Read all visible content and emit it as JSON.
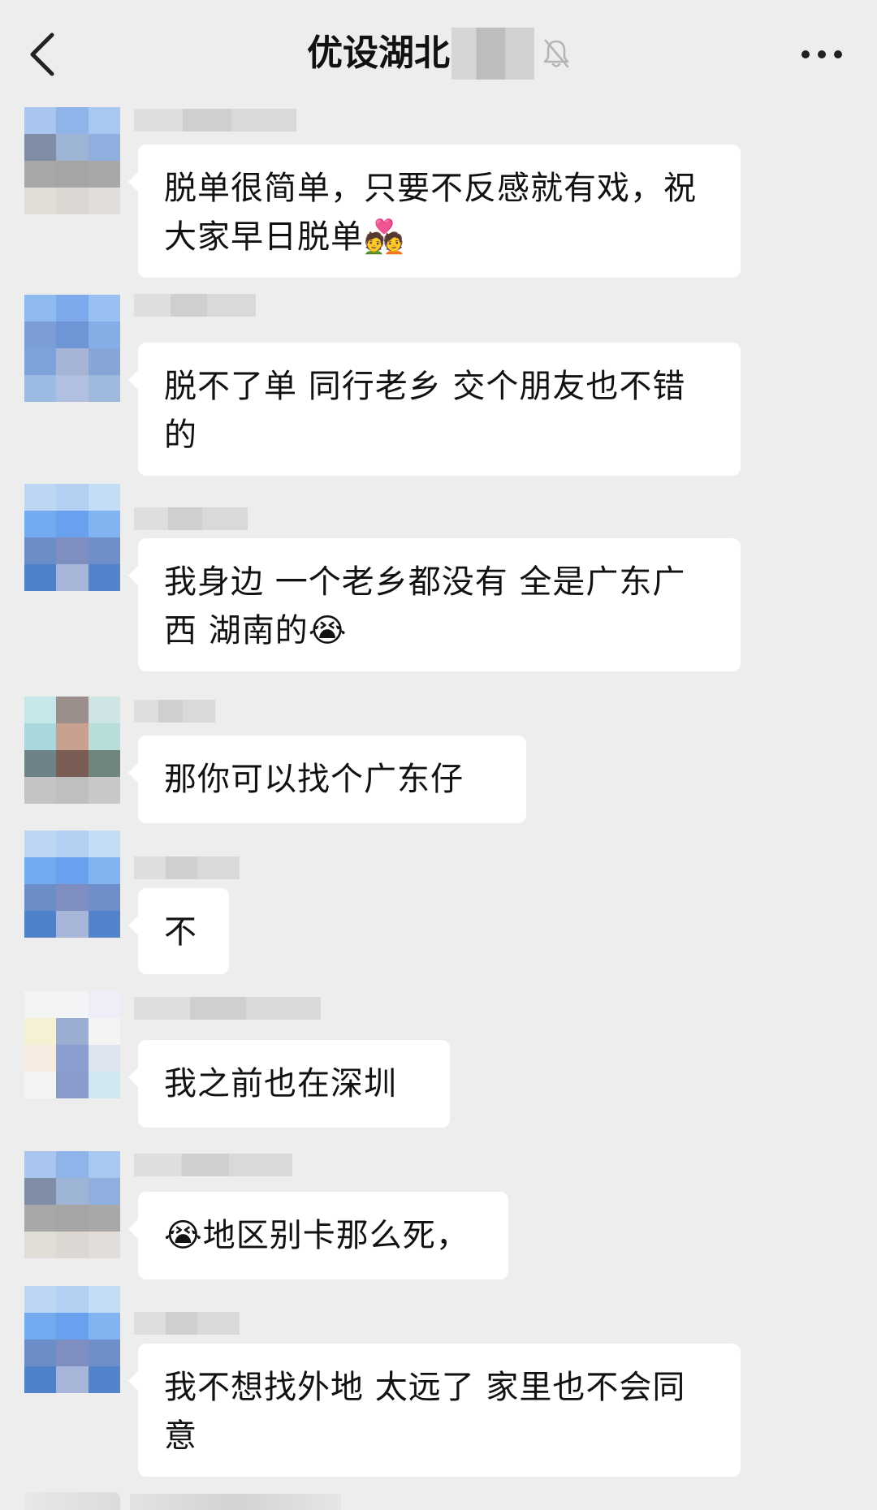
{
  "header": {
    "title": "优设湖北",
    "icons": {
      "back": "chevron-left-icon",
      "mute": "bell-off-icon",
      "more": "more-dots-icon"
    }
  },
  "messages": [
    {
      "text": "脱单很简单，只要不反感就有戏，祝大家早日脱单💑",
      "avatar_colors": [
        "#a9c6ee",
        "#8fb4ea",
        "#a8c8f2",
        "#7f8ea6",
        "#9db4d4",
        "#8fb0df",
        "#a7a7a7",
        "#a5a5a5",
        "#a8a8a8",
        "#e0dcd6",
        "#dcd7d2",
        "#e2ddd8"
      ]
    },
    {
      "text": "脱不了单 同行老乡 交个朋友也不错的",
      "avatar_colors": [
        "#8fbaf0",
        "#7ea9ec",
        "#98c1f2",
        "#7c9ed8",
        "#6e95d6",
        "#86aee6",
        "#7ea2da",
        "#a6b5d6",
        "#86a6d8",
        "#9bbbe3",
        "#b1bfe0",
        "#9eb9de"
      ]
    },
    {
      "text": "我身边 一个老乡都没有 全是广东广西 湖南的😭",
      "avatar_colors": [
        "#bcd6f4",
        "#b4d1f3",
        "#c4ddf6",
        "#74aaf0",
        "#6aa1ee",
        "#82b4f2",
        "#6b8ec8",
        "#7f8ec0",
        "#6f8fca",
        "#4f82c8",
        "#a7b5d9",
        "#5383cb"
      ]
    },
    {
      "text": "那你可以找个广东仔",
      "avatar_colors": [
        "#c6e6ea",
        "#9c8e8a",
        "#cfe4e4",
        "#a9d8dc",
        "#c8a090",
        "#b8dedc",
        "#6f8288",
        "#7a5e56",
        "#6f857e",
        "#c4c4c4",
        "#bfbfbf",
        "#c8c8c8"
      ]
    },
    {
      "text": "不",
      "avatar_colors": [
        "#bcd6f4",
        "#b4d1f3",
        "#c4ddf6",
        "#74aaf0",
        "#6aa1ee",
        "#82b4f2",
        "#6b8ec8",
        "#7f8ec0",
        "#6f8fca",
        "#4f82c8",
        "#a7b5d9",
        "#5383cb"
      ]
    },
    {
      "text": "我之前也在深圳",
      "avatar_colors": [
        "#f3f3f3",
        "#f2f4f6",
        "#eeeef8",
        "#f4f1d4",
        "#9aaed2",
        "#f4f4f4",
        "#f8ece2",
        "#8c9ed0",
        "#dfe5f0",
        "#f2f4f6",
        "#8a9bcb",
        "#cfe8ef"
      ]
    },
    {
      "text": "😭地区别卡那么死，",
      "avatar_colors": [
        "#a9c6ee",
        "#8fb4ea",
        "#a8c8f2",
        "#7f8ea6",
        "#9db4d4",
        "#8fb0df",
        "#a7a7a7",
        "#a5a5a5",
        "#a8a8a8",
        "#e0dcd6",
        "#dcd7d2",
        "#e2ddd8"
      ]
    },
    {
      "text": "我不想找外地 太远了 家里也不会同意",
      "avatar_colors": [
        "#bcd6f4",
        "#b4d1f3",
        "#c4ddf6",
        "#74aaf0",
        "#6aa1ee",
        "#82b4f2",
        "#6b8ec8",
        "#7f8ec0",
        "#6f8fca",
        "#4f82c8",
        "#a7b5d9",
        "#5383cb"
      ]
    }
  ]
}
